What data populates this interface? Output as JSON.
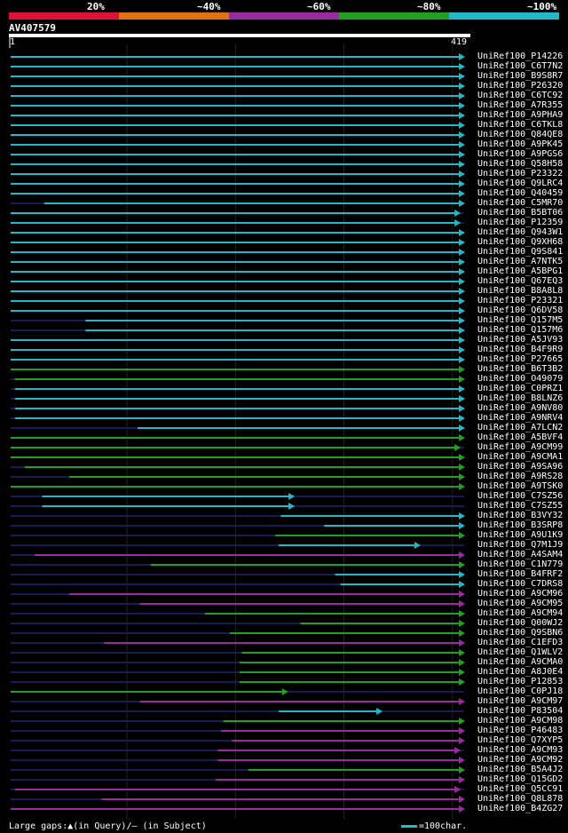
{
  "legend": [
    {
      "label": "20%",
      "color": "#dd1133"
    },
    {
      "label": "~40%",
      "color": "#e07010"
    },
    {
      "label": "~60%",
      "color": "#9a2aa0"
    },
    {
      "label": "~80%",
      "color": "#22a022"
    },
    {
      "label": "~100%",
      "color": "#22b8c8"
    }
  ],
  "query_name": "AV407579",
  "ruler_start": "1",
  "ruler_end": "419",
  "query_length": 419,
  "hits": [
    {
      "name": "UniRef100_P14226",
      "s": 1,
      "e": 419,
      "c": "cyan",
      "arrow": true
    },
    {
      "name": "UniRef100_C6T7N2",
      "s": 1,
      "e": 419,
      "c": "cyan",
      "arrow": true
    },
    {
      "name": "UniRef100_B9S8R7",
      "s": 1,
      "e": 419,
      "c": "cyan",
      "arrow": true
    },
    {
      "name": "UniRef100_P26320",
      "s": 1,
      "e": 419,
      "c": "cyan",
      "arrow": true
    },
    {
      "name": "UniRef100_C6TC92",
      "s": 1,
      "e": 419,
      "c": "cyan",
      "arrow": true
    },
    {
      "name": "UniRef100_A7R355",
      "s": 1,
      "e": 419,
      "c": "cyan",
      "arrow": true
    },
    {
      "name": "UniRef100_A9PHA9",
      "s": 1,
      "e": 419,
      "c": "cyan",
      "arrow": true
    },
    {
      "name": "UniRef100_C6TKL8",
      "s": 1,
      "e": 419,
      "c": "cyan",
      "arrow": true
    },
    {
      "name": "UniRef100_Q84QE8",
      "s": 1,
      "e": 419,
      "c": "cyan",
      "arrow": true
    },
    {
      "name": "UniRef100_A9PK45",
      "s": 1,
      "e": 419,
      "c": "cyan",
      "arrow": true
    },
    {
      "name": "UniRef100_A9PGS6",
      "s": 1,
      "e": 419,
      "c": "cyan",
      "arrow": true
    },
    {
      "name": "UniRef100_Q58H58",
      "s": 1,
      "e": 419,
      "c": "cyan",
      "arrow": true
    },
    {
      "name": "UniRef100_P23322",
      "s": 1,
      "e": 419,
      "c": "cyan",
      "arrow": true
    },
    {
      "name": "UniRef100_Q9LRC4",
      "s": 1,
      "e": 419,
      "c": "cyan",
      "arrow": true
    },
    {
      "name": "UniRef100_Q40459",
      "s": 1,
      "e": 419,
      "c": "cyan",
      "arrow": true
    },
    {
      "name": "UniRef100_C5MR70",
      "s": 32,
      "e": 419,
      "c": "cyan",
      "arrow": true
    },
    {
      "name": "UniRef100_B5BT06",
      "s": 1,
      "e": 415,
      "c": "cyan",
      "arrow": true
    },
    {
      "name": "UniRef100_P12359",
      "s": 1,
      "e": 415,
      "c": "cyan",
      "arrow": true
    },
    {
      "name": "UniRef100_Q943W1",
      "s": 1,
      "e": 419,
      "c": "cyan",
      "arrow": true
    },
    {
      "name": "UniRef100_Q9XH68",
      "s": 1,
      "e": 419,
      "c": "cyan",
      "arrow": true
    },
    {
      "name": "UniRef100_Q9S841",
      "s": 1,
      "e": 419,
      "c": "cyan",
      "arrow": true
    },
    {
      "name": "UniRef100_A7NTK5",
      "s": 1,
      "e": 419,
      "c": "cyan",
      "arrow": true
    },
    {
      "name": "UniRef100_A5BPG1",
      "s": 1,
      "e": 419,
      "c": "cyan",
      "arrow": true
    },
    {
      "name": "UniRef100_Q67EQ3",
      "s": 1,
      "e": 419,
      "c": "cyan",
      "arrow": true
    },
    {
      "name": "UniRef100_B8A8L8",
      "s": 1,
      "e": 419,
      "c": "cyan",
      "arrow": true
    },
    {
      "name": "UniRef100_P23321",
      "s": 1,
      "e": 419,
      "c": "cyan",
      "arrow": true
    },
    {
      "name": "UniRef100_Q6DV58",
      "s": 1,
      "e": 419,
      "c": "cyan",
      "arrow": true
    },
    {
      "name": "UniRef100_Q157M5",
      "s": 70,
      "e": 419,
      "c": "cyan",
      "arrow": true
    },
    {
      "name": "UniRef100_Q157M6",
      "s": 70,
      "e": 419,
      "c": "cyan",
      "arrow": true
    },
    {
      "name": "UniRef100_A5JV93",
      "s": 1,
      "e": 419,
      "c": "cyan",
      "arrow": true
    },
    {
      "name": "UniRef100_B4F9R9",
      "s": 1,
      "e": 419,
      "c": "cyan",
      "arrow": true
    },
    {
      "name": "UniRef100_P27665",
      "s": 1,
      "e": 419,
      "c": "cyan",
      "arrow": true
    },
    {
      "name": "UniRef100_B6T3B2",
      "s": 1,
      "e": 419,
      "c": "green",
      "arrow": true
    },
    {
      "name": "UniRef100_O49079",
      "s": 5,
      "e": 419,
      "c": "green",
      "arrow": true
    },
    {
      "name": "UniRef100_C0PRZ1",
      "s": 5,
      "e": 419,
      "c": "cyan",
      "arrow": true
    },
    {
      "name": "UniRef100_B8LNZ6",
      "s": 5,
      "e": 419,
      "c": "cyan",
      "arrow": true
    },
    {
      "name": "UniRef100_A9NV80",
      "s": 5,
      "e": 419,
      "c": "cyan",
      "arrow": true
    },
    {
      "name": "UniRef100_A9NRV4",
      "s": 5,
      "e": 419,
      "c": "cyan",
      "arrow": true
    },
    {
      "name": "UniRef100_A7LCN2",
      "s": 118,
      "e": 419,
      "c": "cyan",
      "arrow": true
    },
    {
      "name": "UniRef100_A5BVF4",
      "s": 1,
      "e": 419,
      "c": "green",
      "arrow": true
    },
    {
      "name": "UniRef100_A9CM99",
      "s": 1,
      "e": 415,
      "c": "green",
      "arrow": true
    },
    {
      "name": "UniRef100_A9CMA1",
      "s": 1,
      "e": 419,
      "c": "green",
      "arrow": true
    },
    {
      "name": "UniRef100_A9SA96",
      "s": 14,
      "e": 419,
      "c": "green",
      "arrow": true
    },
    {
      "name": "UniRef100_A9RS28",
      "s": 55,
      "e": 419,
      "c": "green",
      "arrow": true
    },
    {
      "name": "UniRef100_A9TSK0",
      "s": 1,
      "e": 419,
      "c": "green",
      "arrow": true
    },
    {
      "name": "UniRef100_C7SZ56",
      "s": 30,
      "e": 262,
      "c": "cyan",
      "arrow": true
    },
    {
      "name": "UniRef100_C7SZ55",
      "s": 30,
      "e": 262,
      "c": "cyan",
      "arrow": true
    },
    {
      "name": "UniRef100_B3VY32",
      "s": 250,
      "e": 419,
      "c": "cyan",
      "arrow": true
    },
    {
      "name": "UniRef100_B3SRP8",
      "s": 290,
      "e": 419,
      "c": "cyan",
      "arrow": true
    },
    {
      "name": "UniRef100_A9U1K9",
      "s": 245,
      "e": 419,
      "c": "green",
      "arrow": true
    },
    {
      "name": "UniRef100_Q7M1J9",
      "s": 248,
      "e": 378,
      "c": "cyan",
      "arrow": true
    },
    {
      "name": "UniRef100_A4SAM4",
      "s": 23,
      "e": 419,
      "c": "purple",
      "arrow": true
    },
    {
      "name": "UniRef100_C1N779",
      "s": 130,
      "e": 419,
      "c": "green",
      "arrow": true
    },
    {
      "name": "UniRef100_B4FRF2",
      "s": 300,
      "e": 419,
      "c": "cyan",
      "arrow": true
    },
    {
      "name": "UniRef100_C7DRS8",
      "s": 305,
      "e": 419,
      "c": "cyan",
      "arrow": true
    },
    {
      "name": "UniRef100_A9CM96",
      "s": 55,
      "e": 419,
      "c": "purple",
      "arrow": true
    },
    {
      "name": "UniRef100_A9CM95",
      "s": 120,
      "e": 419,
      "c": "purple",
      "arrow": true
    },
    {
      "name": "UniRef100_A9CM94",
      "s": 180,
      "e": 419,
      "c": "green",
      "arrow": true
    },
    {
      "name": "UniRef100_Q00WJ2",
      "s": 268,
      "e": 419,
      "c": "green",
      "arrow": true
    },
    {
      "name": "UniRef100_Q9SBN6",
      "s": 203,
      "e": 419,
      "c": "green",
      "arrow": true
    },
    {
      "name": "UniRef100_C1EFD3",
      "s": 87,
      "e": 419,
      "c": "purple",
      "arrow": true
    },
    {
      "name": "UniRef100_Q1WLV2",
      "s": 214,
      "e": 419,
      "c": "green",
      "arrow": true
    },
    {
      "name": "UniRef100_A9CMA0",
      "s": 212,
      "e": 419,
      "c": "green",
      "arrow": true
    },
    {
      "name": "UniRef100_A8J0E4",
      "s": 212,
      "e": 419,
      "c": "green",
      "arrow": true
    },
    {
      "name": "UniRef100_P12853",
      "s": 212,
      "e": 419,
      "c": "green",
      "arrow": true
    },
    {
      "name": "UniRef100_C0PJ18",
      "s": 1,
      "e": 256,
      "c": "green",
      "arrow": true
    },
    {
      "name": "UniRef100_A9CM97",
      "s": 120,
      "e": 419,
      "c": "purple",
      "arrow": true
    },
    {
      "name": "UniRef100_P83504",
      "s": 248,
      "e": 343,
      "c": "cyan",
      "arrow": true
    },
    {
      "name": "UniRef100_A9CM98",
      "s": 197,
      "e": 419,
      "c": "green",
      "arrow": true
    },
    {
      "name": "UniRef100_P46483",
      "s": 195,
      "e": 419,
      "c": "purple",
      "arrow": true
    },
    {
      "name": "UniRef100_Q7XYP5",
      "s": 205,
      "e": 419,
      "c": "purple",
      "arrow": true
    },
    {
      "name": "UniRef100_A9CM93",
      "s": 192,
      "e": 415,
      "c": "purple",
      "arrow": true
    },
    {
      "name": "UniRef100_A9CM92",
      "s": 192,
      "e": 419,
      "c": "purple",
      "arrow": true
    },
    {
      "name": "UniRef100_B5A4J2",
      "s": 220,
      "e": 419,
      "c": "green",
      "arrow": true
    },
    {
      "name": "UniRef100_Q15GD2",
      "s": 190,
      "e": 419,
      "c": "purple",
      "arrow": true
    },
    {
      "name": "UniRef100_Q5CC91",
      "s": 5,
      "e": 415,
      "c": "purple",
      "arrow": true
    },
    {
      "name": "UniRef100_Q8L878",
      "s": 85,
      "e": 419,
      "c": "purple",
      "arrow": true
    },
    {
      "name": "UniRef100_B4ZG27",
      "s": 1,
      "e": 419,
      "c": "purple",
      "arrow": true
    }
  ],
  "colors": {
    "cyan": "#22b8c8",
    "green": "#22a022",
    "purple": "#9a2aa0",
    "dim": "#1a1a55"
  },
  "footer_text": "Large gaps:▲(in Query)/– (in Subject)",
  "scale_text": "=100char."
}
